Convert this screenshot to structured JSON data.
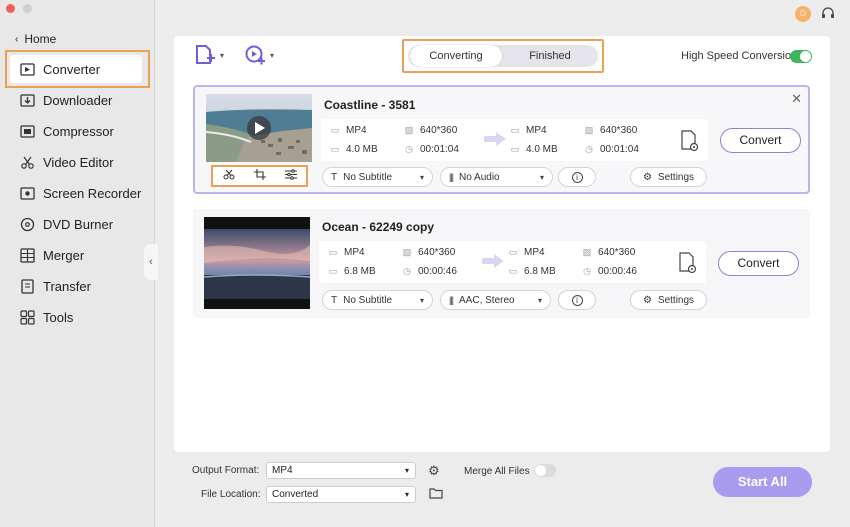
{
  "window": {
    "traffic_colors": [
      "#f25f57",
      "#d0d0d0",
      "#d0d0d0"
    ]
  },
  "header": {
    "avatar_icon": "user-icon",
    "support_icon": "headset-icon"
  },
  "sidebar": {
    "home_label": "Home",
    "items": [
      {
        "label": "Converter",
        "icon": "converter-icon"
      },
      {
        "label": "Downloader",
        "icon": "download-icon"
      },
      {
        "label": "Compressor",
        "icon": "compress-icon"
      },
      {
        "label": "Video Editor",
        "icon": "scissors-icon"
      },
      {
        "label": "Screen Recorder",
        "icon": "screen-record-icon"
      },
      {
        "label": "DVD Burner",
        "icon": "disc-icon"
      },
      {
        "label": "Merger",
        "icon": "merge-icon"
      },
      {
        "label": "Transfer",
        "icon": "transfer-icon"
      },
      {
        "label": "Tools",
        "icon": "grid-icon"
      }
    ]
  },
  "toolbar": {
    "tabs": [
      {
        "label": "Converting"
      },
      {
        "label": "Finished"
      }
    ],
    "high_speed_label": "High Speed Conversion",
    "high_speed_on": true,
    "accent": "#3fb65b"
  },
  "files": [
    {
      "title": "Coastline - 3581",
      "src": {
        "format": "MP4",
        "resolution": "640*360",
        "size": "4.0 MB",
        "duration": "00:01:04"
      },
      "dst": {
        "format": "MP4",
        "resolution": "640*360",
        "size": "4.0 MB",
        "duration": "00:01:04"
      },
      "subtitle": "No Subtitle",
      "audio": "No Audio",
      "settings_label": "Settings",
      "convert_label": "Convert"
    },
    {
      "title": "Ocean - 62249 copy",
      "src": {
        "format": "MP4",
        "resolution": "640*360",
        "size": "6.8 MB",
        "duration": "00:00:46"
      },
      "dst": {
        "format": "MP4",
        "resolution": "640*360",
        "size": "6.8 MB",
        "duration": "00:00:46"
      },
      "subtitle": "No Subtitle",
      "audio": "AAC, Stereo",
      "settings_label": "Settings",
      "convert_label": "Convert"
    }
  ],
  "footer": {
    "output_format_label": "Output Format:",
    "output_format_value": "MP4",
    "merge_label": "Merge All Files",
    "merge_on": false,
    "file_location_label": "File Location:",
    "file_location_value": "Converted",
    "start_all_label": "Start All"
  }
}
